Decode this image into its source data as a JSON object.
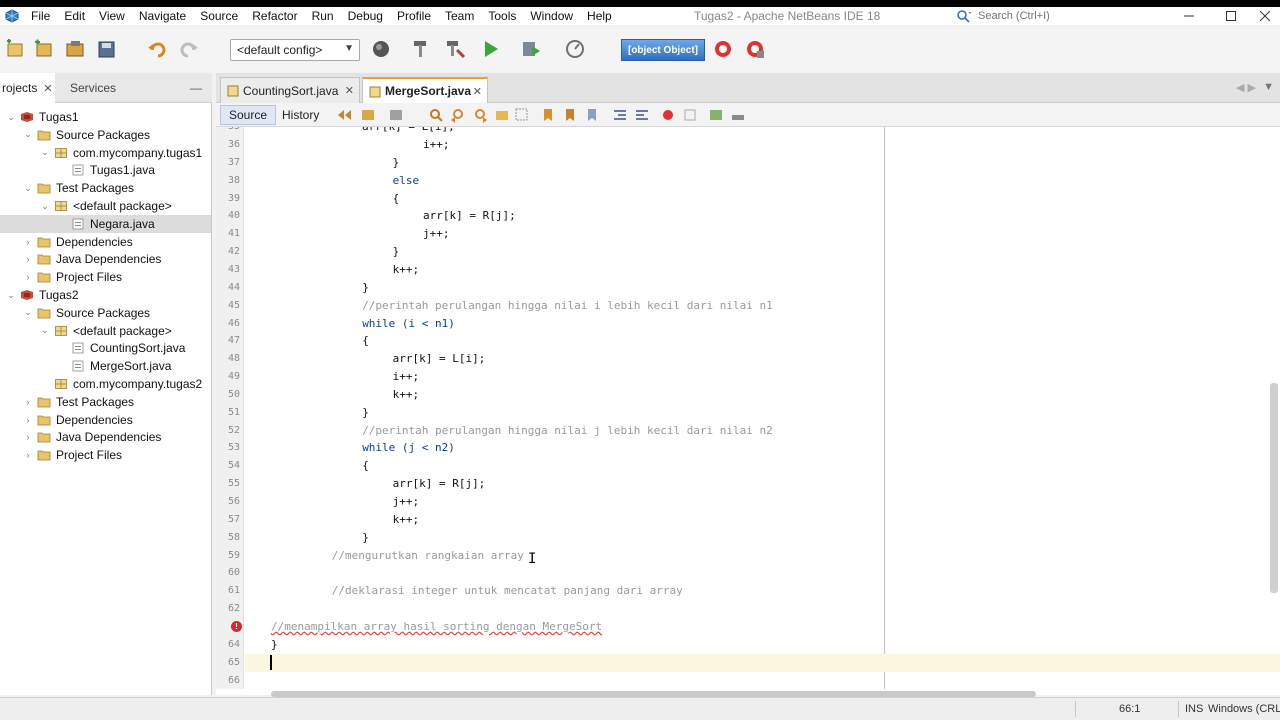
{
  "menubar": {
    "items": [
      "File",
      "Edit",
      "View",
      "Navigate",
      "Source",
      "Refactor",
      "Run",
      "Debug",
      "Profile",
      "Team",
      "Tools",
      "Window",
      "Help"
    ],
    "title": "Tugas2 - Apache NetBeans IDE 18",
    "search_placeholder": "Search (Ctrl+I)"
  },
  "toolbar": {
    "config": "<default config>",
    "memory": "[object Object]"
  },
  "left_panel": {
    "tabs": [
      "rojects",
      "Services"
    ],
    "tree": [
      {
        "label": "Tugas1",
        "level": 0,
        "icon": "project",
        "toggle": "open",
        "selected": false
      },
      {
        "label": "Source Packages",
        "level": 1,
        "icon": "folder",
        "toggle": "open",
        "selected": false
      },
      {
        "label": "com.mycompany.tugas1",
        "level": 2,
        "icon": "package",
        "toggle": "open",
        "selected": false
      },
      {
        "label": "Tugas1.java",
        "level": 3,
        "icon": "java",
        "toggle": "",
        "selected": false
      },
      {
        "label": "Test Packages",
        "level": 1,
        "icon": "folder",
        "toggle": "open",
        "selected": false
      },
      {
        "label": "<default package>",
        "level": 2,
        "icon": "package",
        "toggle": "open",
        "selected": false
      },
      {
        "label": "Negara.java",
        "level": 3,
        "icon": "java",
        "toggle": "",
        "selected": true
      },
      {
        "label": "Dependencies",
        "level": 1,
        "icon": "folder",
        "toggle": "closed",
        "selected": false
      },
      {
        "label": "Java Dependencies",
        "level": 1,
        "icon": "folder",
        "toggle": "closed",
        "selected": false
      },
      {
        "label": "Project Files",
        "level": 1,
        "icon": "folder",
        "toggle": "closed",
        "selected": false
      },
      {
        "label": "Tugas2",
        "level": 0,
        "icon": "project",
        "toggle": "open",
        "selected": false
      },
      {
        "label": "Source Packages",
        "level": 1,
        "icon": "folder",
        "toggle": "open",
        "selected": false
      },
      {
        "label": "<default package>",
        "level": 2,
        "icon": "package",
        "toggle": "open",
        "selected": false
      },
      {
        "label": "CountingSort.java",
        "level": 3,
        "icon": "java",
        "toggle": "",
        "selected": false
      },
      {
        "label": "MergeSort.java",
        "level": 3,
        "icon": "java",
        "toggle": "",
        "selected": false
      },
      {
        "label": "com.mycompany.tugas2",
        "level": 2,
        "icon": "package",
        "toggle": "",
        "selected": false
      },
      {
        "label": "Test Packages",
        "level": 1,
        "icon": "folder",
        "toggle": "closed",
        "selected": false
      },
      {
        "label": "Dependencies",
        "level": 1,
        "icon": "folder",
        "toggle": "closed",
        "selected": false
      },
      {
        "label": "Java Dependencies",
        "level": 1,
        "icon": "folder",
        "toggle": "closed",
        "selected": false
      },
      {
        "label": "Project Files",
        "level": 1,
        "icon": "folder",
        "toggle": "closed",
        "selected": false
      }
    ]
  },
  "editor": {
    "tabs": [
      {
        "label": "CountingSort.java",
        "active": false
      },
      {
        "label": "MergeSort.java",
        "active": true
      }
    ],
    "views": [
      "Source",
      "History"
    ],
    "lines": [
      {
        "n": "36",
        "indent": 20,
        "text": "i++;",
        "type": "code"
      },
      {
        "n": "37",
        "indent": 16,
        "text": "}",
        "type": "code"
      },
      {
        "n": "38",
        "indent": 16,
        "text": "else",
        "type": "kw"
      },
      {
        "n": "39",
        "indent": 16,
        "text": "{",
        "type": "code"
      },
      {
        "n": "40",
        "indent": 20,
        "text": "arr[k] = R[j];",
        "type": "code"
      },
      {
        "n": "41",
        "indent": 20,
        "text": "j++;",
        "type": "code"
      },
      {
        "n": "42",
        "indent": 16,
        "text": "}",
        "type": "code"
      },
      {
        "n": "43",
        "indent": 16,
        "text": "k++;",
        "type": "code"
      },
      {
        "n": "44",
        "indent": 12,
        "text": "}",
        "type": "code"
      },
      {
        "n": "45",
        "indent": 12,
        "text": "//perintah perulangan hingga nilai i lebih kecil dari nilai n1",
        "type": "comment"
      },
      {
        "n": "46",
        "indent": 12,
        "text": "while (i < n1)",
        "type": "kwline"
      },
      {
        "n": "47",
        "indent": 12,
        "text": "{",
        "type": "code"
      },
      {
        "n": "48",
        "indent": 16,
        "text": "arr[k] = L[i];",
        "type": "code"
      },
      {
        "n": "49",
        "indent": 16,
        "text": "i++;",
        "type": "code"
      },
      {
        "n": "50",
        "indent": 16,
        "text": "k++;",
        "type": "code"
      },
      {
        "n": "51",
        "indent": 12,
        "text": "}",
        "type": "code"
      },
      {
        "n": "52",
        "indent": 12,
        "text": "//perintah perulangan hingga nilai j lebih kecil dari nilai n2",
        "type": "comment"
      },
      {
        "n": "53",
        "indent": 12,
        "text": "while (j < n2)",
        "type": "kwline"
      },
      {
        "n": "54",
        "indent": 12,
        "text": "{",
        "type": "code"
      },
      {
        "n": "55",
        "indent": 16,
        "text": "arr[k] = R[j];",
        "type": "code"
      },
      {
        "n": "56",
        "indent": 16,
        "text": "j++;",
        "type": "code"
      },
      {
        "n": "57",
        "indent": 16,
        "text": "k++;",
        "type": "code"
      },
      {
        "n": "58",
        "indent": 12,
        "text": "}",
        "type": "code"
      },
      {
        "n": "59",
        "indent": 8,
        "text": "//mengurutkan rangkaian array",
        "type": "comment"
      },
      {
        "n": "60",
        "indent": 0,
        "text": "",
        "type": "code"
      },
      {
        "n": "61",
        "indent": 8,
        "text": "//deklarasi integer untuk mencatat panjang dari array",
        "type": "comment"
      },
      {
        "n": "62",
        "indent": 0,
        "text": "",
        "type": "code"
      },
      {
        "n": "",
        "indent": 0,
        "text": "//menampilkan array hasil sorting dengan MergeSort",
        "type": "error"
      },
      {
        "n": "64",
        "indent": 0,
        "text": "}",
        "type": "code"
      },
      {
        "n": "65",
        "indent": 0,
        "text": "",
        "type": "current"
      },
      {
        "n": "66",
        "indent": 0,
        "text": "",
        "type": "code"
      }
    ]
  },
  "status": {
    "position": "66:1",
    "mode": "INS",
    "line_ending": "Windows (CRL"
  }
}
